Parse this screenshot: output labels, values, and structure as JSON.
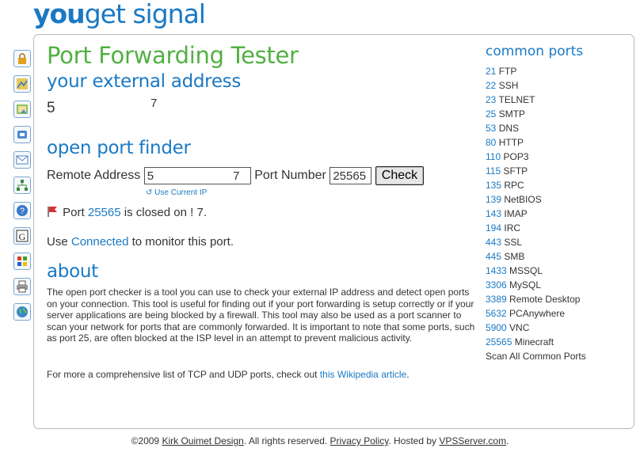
{
  "logo": {
    "you": "you",
    "rest": "get signal"
  },
  "sidebar": {
    "icons": [
      "lock-icon",
      "map-icon",
      "image-icon",
      "phone-icon",
      "mail-icon",
      "network-icon",
      "help-icon",
      "google-icon",
      "windows-icon",
      "printer-icon",
      "globe-icon"
    ]
  },
  "main": {
    "title": "Port Forwarding Tester",
    "external_heading": "your external address",
    "external_ip_start": "5",
    "external_ip_end": "7",
    "finder_heading": "open port finder",
    "remote_label": "Remote Address",
    "remote_value": "5                        7",
    "port_label": "Port Number",
    "port_value": "25565",
    "check_label": "Check",
    "use_ip_label": "Use Current IP",
    "result_prefix": "Port",
    "result_port": "25565",
    "result_mid": "is closed on",
    "result_ip": "!                   7.",
    "monitor_prefix": "Use",
    "monitor_link": "Connected",
    "monitor_suffix": "to monitor this port.",
    "about_heading": "about",
    "about_text": "The open port checker is a tool you can use to check your external IP address and detect open ports on your connection. This tool is useful for finding out if your port forwarding is setup correctly or if your server applications are being blocked by a firewall. This tool may also be used as a port scanner to scan your network for ports that are commonly forwarded. It is important to note that some ports, such as port 25, are often blocked at the ISP level in an attempt to prevent malicious activity.",
    "more_prefix": "For more a comprehensive list of TCP and UDP ports, check out",
    "more_link": "this Wikipedia article",
    "more_suffix": "."
  },
  "common_ports": {
    "heading": "common ports",
    "items": [
      {
        "num": "21",
        "name": "FTP"
      },
      {
        "num": "22",
        "name": "SSH"
      },
      {
        "num": "23",
        "name": "TELNET"
      },
      {
        "num": "25",
        "name": "SMTP"
      },
      {
        "num": "53",
        "name": "DNS"
      },
      {
        "num": "80",
        "name": "HTTP"
      },
      {
        "num": "110",
        "name": "POP3"
      },
      {
        "num": "115",
        "name": "SFTP"
      },
      {
        "num": "135",
        "name": "RPC"
      },
      {
        "num": "139",
        "name": "NetBIOS"
      },
      {
        "num": "143",
        "name": "IMAP"
      },
      {
        "num": "194",
        "name": "IRC"
      },
      {
        "num": "443",
        "name": "SSL"
      },
      {
        "num": "445",
        "name": "SMB"
      },
      {
        "num": "1433",
        "name": "MSSQL"
      },
      {
        "num": "3306",
        "name": "MySQL"
      },
      {
        "num": "3389",
        "name": "Remote Desktop"
      },
      {
        "num": "5632",
        "name": "PCAnywhere"
      },
      {
        "num": "5900",
        "name": "VNC"
      },
      {
        "num": "25565",
        "name": "Minecraft"
      }
    ],
    "scan_all": "Scan All Common Ports"
  },
  "footer": {
    "copyright": "©2009",
    "author": "Kirk Ouimet Design",
    "rights": ". All rights reserved.",
    "privacy": "Privacy Policy",
    "hosted": ". Hosted by",
    "host": "VPSServer.com",
    "end": "."
  },
  "colors": {
    "green": "#52b043",
    "blue": "#1a79c4"
  }
}
